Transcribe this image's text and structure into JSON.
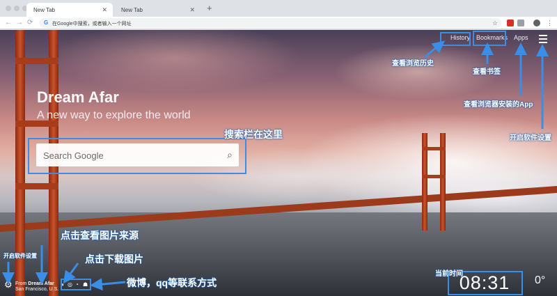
{
  "browser": {
    "tabs": [
      {
        "label": "New Tab",
        "active": true
      },
      {
        "label": "New Tab",
        "active": false
      }
    ],
    "omnibox_placeholder": "在Google中搜索，或者输入一个网址"
  },
  "page": {
    "nav": {
      "history": "History",
      "bookmarks": "Bookmarks",
      "apps": "Apps"
    },
    "brand": "Dream Afar",
    "tagline": "A new way to explore the world",
    "search_placeholder": "Search Google",
    "credit": {
      "prefix": "From",
      "source": "Dream Afar",
      "location": "San Francisco, U.S."
    },
    "clock": "08:31",
    "temperature": "0°"
  },
  "annotations": {
    "history": "查看浏览历史",
    "bookmarks": "查看书签",
    "apps": "查看浏览器安装的App",
    "settings_top": "开启软件设置",
    "search": "搜索栏在这里",
    "image_source": "点击查看图片来源",
    "download": "点击下载图片",
    "contact": "微博，qq等联系方式",
    "settings_bottom": "开启软件设置",
    "time": "当前时间"
  },
  "colors": {
    "annotation": "#3a8ee6"
  }
}
